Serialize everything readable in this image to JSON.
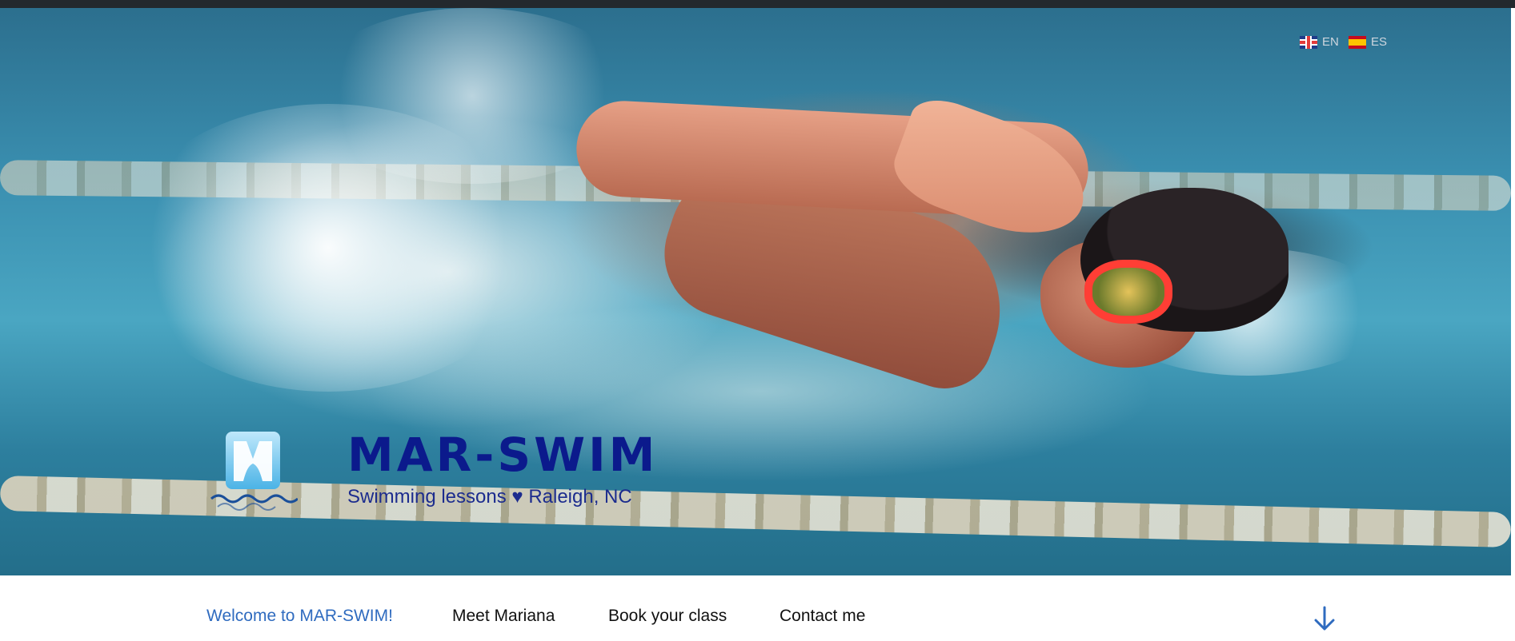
{
  "language_switcher": [
    {
      "code": "EN",
      "icon": "uk-flag-icon"
    },
    {
      "code": "ES",
      "icon": "spain-flag-icon"
    }
  ],
  "site": {
    "title": "MAR-SWIM",
    "tagline": "Swimming lessons ♥ Raleigh, NC",
    "logo_icon": "mar-swim-logo-icon"
  },
  "nav": {
    "items": [
      {
        "label": "Welcome to MAR-SWIM!",
        "active": true
      },
      {
        "label": "Meet Mariana",
        "active": false
      },
      {
        "label": "Book your class",
        "active": false
      },
      {
        "label": "Contact me",
        "active": false
      }
    ],
    "scroll_icon": "arrow-down-icon"
  },
  "colors": {
    "title": "#0b1a8c",
    "tagline": "#1c2c8e",
    "nav_active": "#2f6bbf",
    "nav_text": "#111111",
    "topbar": "#23282d"
  }
}
